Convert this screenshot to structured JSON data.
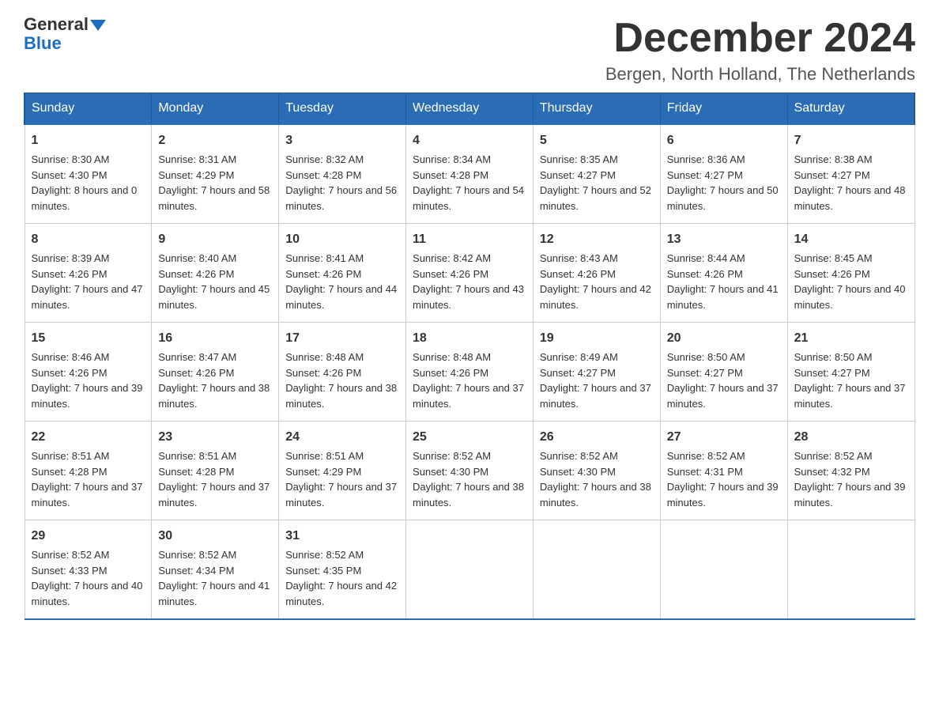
{
  "header": {
    "logo_line1": "General",
    "logo_line2": "Blue",
    "month_title": "December 2024",
    "location": "Bergen, North Holland, The Netherlands"
  },
  "weekdays": [
    "Sunday",
    "Monday",
    "Tuesday",
    "Wednesday",
    "Thursday",
    "Friday",
    "Saturday"
  ],
  "weeks": [
    [
      {
        "day": "1",
        "sunrise": "8:30 AM",
        "sunset": "4:30 PM",
        "daylight": "8 hours and 0 minutes."
      },
      {
        "day": "2",
        "sunrise": "8:31 AM",
        "sunset": "4:29 PM",
        "daylight": "7 hours and 58 minutes."
      },
      {
        "day": "3",
        "sunrise": "8:32 AM",
        "sunset": "4:28 PM",
        "daylight": "7 hours and 56 minutes."
      },
      {
        "day": "4",
        "sunrise": "8:34 AM",
        "sunset": "4:28 PM",
        "daylight": "7 hours and 54 minutes."
      },
      {
        "day": "5",
        "sunrise": "8:35 AM",
        "sunset": "4:27 PM",
        "daylight": "7 hours and 52 minutes."
      },
      {
        "day": "6",
        "sunrise": "8:36 AM",
        "sunset": "4:27 PM",
        "daylight": "7 hours and 50 minutes."
      },
      {
        "day": "7",
        "sunrise": "8:38 AM",
        "sunset": "4:27 PM",
        "daylight": "7 hours and 48 minutes."
      }
    ],
    [
      {
        "day": "8",
        "sunrise": "8:39 AM",
        "sunset": "4:26 PM",
        "daylight": "7 hours and 47 minutes."
      },
      {
        "day": "9",
        "sunrise": "8:40 AM",
        "sunset": "4:26 PM",
        "daylight": "7 hours and 45 minutes."
      },
      {
        "day": "10",
        "sunrise": "8:41 AM",
        "sunset": "4:26 PM",
        "daylight": "7 hours and 44 minutes."
      },
      {
        "day": "11",
        "sunrise": "8:42 AM",
        "sunset": "4:26 PM",
        "daylight": "7 hours and 43 minutes."
      },
      {
        "day": "12",
        "sunrise": "8:43 AM",
        "sunset": "4:26 PM",
        "daylight": "7 hours and 42 minutes."
      },
      {
        "day": "13",
        "sunrise": "8:44 AM",
        "sunset": "4:26 PM",
        "daylight": "7 hours and 41 minutes."
      },
      {
        "day": "14",
        "sunrise": "8:45 AM",
        "sunset": "4:26 PM",
        "daylight": "7 hours and 40 minutes."
      }
    ],
    [
      {
        "day": "15",
        "sunrise": "8:46 AM",
        "sunset": "4:26 PM",
        "daylight": "7 hours and 39 minutes."
      },
      {
        "day": "16",
        "sunrise": "8:47 AM",
        "sunset": "4:26 PM",
        "daylight": "7 hours and 38 minutes."
      },
      {
        "day": "17",
        "sunrise": "8:48 AM",
        "sunset": "4:26 PM",
        "daylight": "7 hours and 38 minutes."
      },
      {
        "day": "18",
        "sunrise": "8:48 AM",
        "sunset": "4:26 PM",
        "daylight": "7 hours and 37 minutes."
      },
      {
        "day": "19",
        "sunrise": "8:49 AM",
        "sunset": "4:27 PM",
        "daylight": "7 hours and 37 minutes."
      },
      {
        "day": "20",
        "sunrise": "8:50 AM",
        "sunset": "4:27 PM",
        "daylight": "7 hours and 37 minutes."
      },
      {
        "day": "21",
        "sunrise": "8:50 AM",
        "sunset": "4:27 PM",
        "daylight": "7 hours and 37 minutes."
      }
    ],
    [
      {
        "day": "22",
        "sunrise": "8:51 AM",
        "sunset": "4:28 PM",
        "daylight": "7 hours and 37 minutes."
      },
      {
        "day": "23",
        "sunrise": "8:51 AM",
        "sunset": "4:28 PM",
        "daylight": "7 hours and 37 minutes."
      },
      {
        "day": "24",
        "sunrise": "8:51 AM",
        "sunset": "4:29 PM",
        "daylight": "7 hours and 37 minutes."
      },
      {
        "day": "25",
        "sunrise": "8:52 AM",
        "sunset": "4:30 PM",
        "daylight": "7 hours and 38 minutes."
      },
      {
        "day": "26",
        "sunrise": "8:52 AM",
        "sunset": "4:30 PM",
        "daylight": "7 hours and 38 minutes."
      },
      {
        "day": "27",
        "sunrise": "8:52 AM",
        "sunset": "4:31 PM",
        "daylight": "7 hours and 39 minutes."
      },
      {
        "day": "28",
        "sunrise": "8:52 AM",
        "sunset": "4:32 PM",
        "daylight": "7 hours and 39 minutes."
      }
    ],
    [
      {
        "day": "29",
        "sunrise": "8:52 AM",
        "sunset": "4:33 PM",
        "daylight": "7 hours and 40 minutes."
      },
      {
        "day": "30",
        "sunrise": "8:52 AM",
        "sunset": "4:34 PM",
        "daylight": "7 hours and 41 minutes."
      },
      {
        "day": "31",
        "sunrise": "8:52 AM",
        "sunset": "4:35 PM",
        "daylight": "7 hours and 42 minutes."
      },
      null,
      null,
      null,
      null
    ]
  ]
}
